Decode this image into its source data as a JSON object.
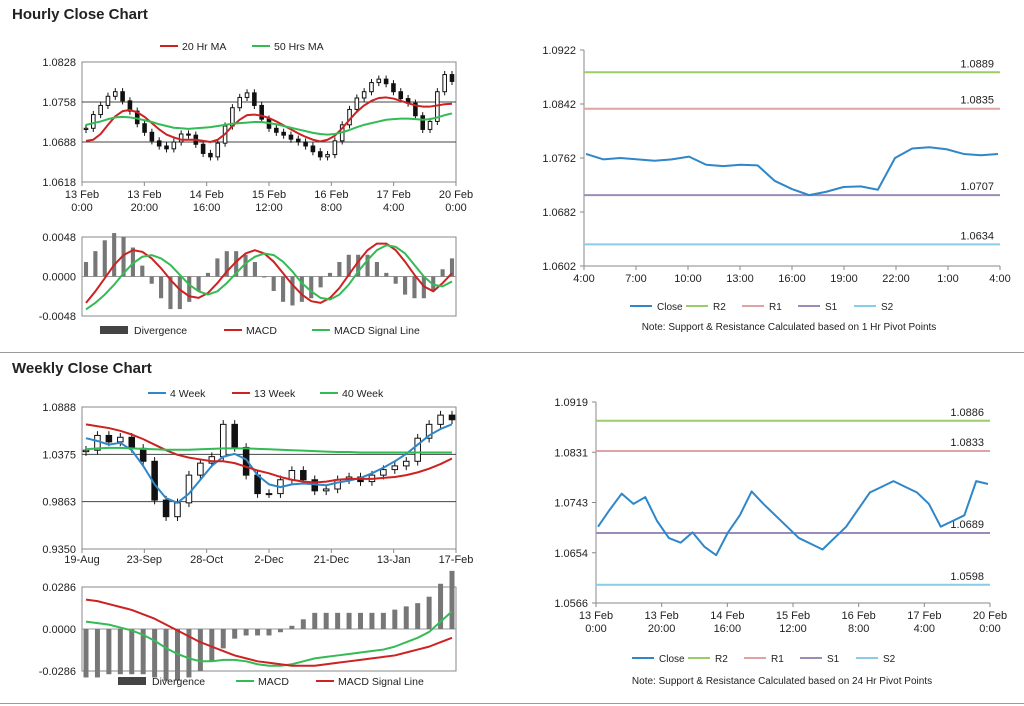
{
  "sections": {
    "hourly_title": "Hourly Close Chart",
    "weekly_title": "Weekly Close Chart"
  },
  "colors": {
    "red": "#cc2222",
    "green": "#33bb55",
    "blue": "#2f86c8",
    "r2": "#9ccc6a",
    "r1": "#e0a3a3",
    "s1": "#9b8bb8",
    "s2": "#88cce6",
    "bar": "#777777"
  },
  "chart_data": [
    {
      "id": "hourly_price",
      "type": "candlestick",
      "legend": [
        "20 Hr MA",
        "50 Hrs MA"
      ],
      "yticks": [
        "1.0828",
        "1.0758",
        "1.0688",
        "1.0618"
      ],
      "ylim": [
        1.0618,
        1.0828
      ],
      "xticks": [
        [
          "13 Feb",
          "0:00"
        ],
        [
          "13 Feb",
          "20:00"
        ],
        [
          "14 Feb",
          "16:00"
        ],
        [
          "15 Feb",
          "12:00"
        ],
        [
          "16 Feb",
          "8:00"
        ],
        [
          "17 Feb",
          "4:00"
        ],
        [
          "20 Feb",
          "0:00"
        ]
      ],
      "close": [
        1.0712,
        1.0736,
        1.0752,
        1.0768,
        1.0776,
        1.076,
        1.0742,
        1.072,
        1.0705,
        1.069,
        1.0681,
        1.0676,
        1.0688,
        1.0702,
        1.07,
        1.0684,
        1.0668,
        1.0662,
        1.0686,
        1.0716,
        1.0748,
        1.0766,
        1.0774,
        1.0752,
        1.0728,
        1.0712,
        1.0705,
        1.07,
        1.0693,
        1.0688,
        1.0681,
        1.0671,
        1.0662,
        1.0666,
        1.069,
        1.0718,
        1.0745,
        1.0765,
        1.0776,
        1.0792,
        1.0798,
        1.079,
        1.0776,
        1.0764,
        1.0756,
        1.0734,
        1.071,
        1.0724,
        1.0776,
        1.0806,
        1.0794
      ],
      "ma20": [
        1.069,
        1.0692,
        1.0702,
        1.0718,
        1.0733,
        1.0742,
        1.0744,
        1.074,
        1.0732,
        1.0721,
        1.071,
        1.0701,
        1.0696,
        1.0692,
        1.0692,
        1.0692,
        1.069,
        1.0688,
        1.0692,
        1.0702,
        1.0716,
        1.0727,
        1.0735,
        1.0736,
        1.0734,
        1.073,
        1.0724,
        1.0717,
        1.071,
        1.0703,
        1.0697,
        1.0692,
        1.0689,
        1.0692,
        1.0699,
        1.0712,
        1.0727,
        1.0741,
        1.0752,
        1.076,
        1.0765,
        1.0766,
        1.0764,
        1.076,
        1.0756,
        1.0752,
        1.075,
        1.075,
        1.0752,
        1.0754,
        1.0755
      ],
      "ma50": [
        1.0718,
        1.0721,
        1.0724,
        1.0728,
        1.0731,
        1.0732,
        1.0731,
        1.0729,
        1.0726,
        1.0723,
        1.0719,
        1.0716,
        1.0713,
        1.0712,
        1.0711,
        1.0712,
        1.0713,
        1.0714,
        1.0716,
        1.0718,
        1.072,
        1.0721,
        1.0722,
        1.0723,
        1.0723,
        1.0721,
        1.0719,
        1.0716,
        1.0713,
        1.071,
        1.0707,
        1.0704,
        1.0702,
        1.0701,
        1.0702,
        1.0705,
        1.0709,
        1.0714,
        1.0718,
        1.0721,
        1.0724,
        1.0727,
        1.0728,
        1.0729,
        1.0729,
        1.0728,
        1.0727,
        1.0728,
        1.0731,
        1.0735,
        1.0738
      ]
    },
    {
      "id": "hourly_macd",
      "type": "macd",
      "yticks": [
        "0.0048",
        "0.0000",
        "-0.0048"
      ],
      "ylim": [
        -0.0048,
        0.0048
      ],
      "legend": [
        "Divergence",
        "MACD",
        "MACD Signal Line"
      ],
      "macd": [
        -0.0032,
        -0.0018,
        -0.0002,
        0.0014,
        0.0026,
        0.0032,
        0.003,
        0.0022,
        0.001,
        -0.0004,
        -0.0016,
        -0.0024,
        -0.0026,
        -0.002,
        -0.0008,
        0.0006,
        0.0018,
        0.0028,
        0.0032,
        0.0028,
        0.0018,
        0.0004,
        -0.001,
        -0.0022,
        -0.003,
        -0.0032,
        -0.0026,
        -0.0014,
        0.0002,
        0.0018,
        0.0032,
        0.004,
        0.004,
        0.0032,
        0.0018,
        0.0002,
        -0.0012,
        -0.0018,
        -0.0008,
        0.0004
      ],
      "signal": [
        -0.004,
        -0.0032,
        -0.0022,
        -0.001,
        0.0004,
        0.0016,
        0.0024,
        0.0026,
        0.0022,
        0.0014,
        0.0002,
        -0.001,
        -0.0018,
        -0.0022,
        -0.0018,
        -0.0008,
        0.0004,
        0.0016,
        0.0024,
        0.0028,
        0.0026,
        0.0018,
        0.0006,
        -0.0008,
        -0.0018,
        -0.0026,
        -0.0028,
        -0.0022,
        -0.001,
        0.0006,
        0.002,
        0.0032,
        0.0038,
        0.0036,
        0.0028,
        0.0014,
        0.0,
        -0.001,
        -0.0012,
        -0.0006
      ]
    },
    {
      "id": "hourly_pivots",
      "type": "line",
      "ylim": [
        1.0602,
        1.0922
      ],
      "yticks": [
        "1.0922",
        "1.0842",
        "1.0762",
        "1.0682",
        "1.0602"
      ],
      "xticks": [
        "4:00",
        "7:00",
        "10:00",
        "13:00",
        "16:00",
        "19:00",
        "22:00",
        "1:00",
        "4:00"
      ],
      "close": [
        1.0768,
        1.076,
        1.0762,
        1.076,
        1.0758,
        1.076,
        1.0764,
        1.0752,
        1.075,
        1.0752,
        1.0751,
        1.0728,
        1.0716,
        1.0707,
        1.0712,
        1.0719,
        1.072,
        1.0715,
        1.0762,
        1.0776,
        1.0778,
        1.0775,
        1.0768,
        1.0766,
        1.0768
      ],
      "levels": [
        {
          "name": "R2",
          "value": 1.0889,
          "label": "1.0889"
        },
        {
          "name": "R1",
          "value": 1.0835,
          "label": "1.0835"
        },
        {
          "name": "S1",
          "value": 1.0707,
          "label": "1.0707"
        },
        {
          "name": "S2",
          "value": 1.0634,
          "label": "1.0634"
        }
      ],
      "legend": [
        "Close",
        "R2",
        "R1",
        "S1",
        "S2"
      ],
      "note": "Note: Support & Resistance Calculated based on 1 Hr Pivot Points"
    },
    {
      "id": "weekly_price",
      "type": "candlestick",
      "legend": [
        "4 Week",
        "13 Week",
        "40 Week"
      ],
      "yticks": [
        "1.0888",
        "1.0375",
        "0.9863",
        "0.9350"
      ],
      "ylim": [
        0.935,
        1.0888
      ],
      "xticks": [
        "19-Aug",
        "23-Sep",
        "28-Oct",
        "2-Dec",
        "21-Dec",
        "13-Jan",
        "17-Feb"
      ],
      "close": [
        1.042,
        1.058,
        1.051,
        1.056,
        1.044,
        1.03,
        0.988,
        0.97,
        0.985,
        1.015,
        1.028,
        1.035,
        1.07,
        1.045,
        1.015,
        0.995,
        0.995,
        1.01,
        1.02,
        1.01,
        0.998,
        1.0,
        1.01,
        1.013,
        1.008,
        1.015,
        1.021,
        1.025,
        1.03,
        1.055,
        1.07,
        1.08,
        1.075
      ],
      "ma4": [
        1.055,
        1.052,
        1.048,
        1.05,
        1.042,
        1.025,
        1.005,
        0.99,
        0.985,
        0.995,
        1.01,
        1.025,
        1.035,
        1.038,
        1.032,
        1.015,
        1.005,
        1.002,
        1.005,
        1.006,
        1.005,
        1.004,
        1.007,
        1.009,
        1.012,
        1.017,
        1.023,
        1.03,
        1.038,
        1.048,
        1.058,
        1.065,
        1.07
      ],
      "ma13": [
        1.07,
        1.068,
        1.066,
        1.063,
        1.059,
        1.054,
        1.048,
        1.042,
        1.037,
        1.034,
        1.032,
        1.03,
        1.03,
        1.028,
        1.024,
        1.02,
        1.017,
        1.013,
        1.01,
        1.008,
        1.007,
        1.008,
        1.01,
        1.011,
        1.011,
        1.011,
        1.012,
        1.013,
        1.015,
        1.018,
        1.022,
        1.027,
        1.033
      ],
      "ma40": [
        1.043,
        1.044,
        1.0445,
        1.0445,
        1.044,
        1.0435,
        1.043,
        1.0425,
        1.0425,
        1.0425,
        1.043,
        1.0435,
        1.044,
        1.044,
        1.044,
        1.0435,
        1.043,
        1.0425,
        1.042,
        1.0415,
        1.041,
        1.0405,
        1.04,
        1.04,
        1.0395,
        1.0395,
        1.0395,
        1.0395,
        1.0395,
        1.0395,
        1.0395,
        1.0395,
        1.0395
      ]
    },
    {
      "id": "weekly_macd",
      "type": "macd",
      "yticks": [
        "0.0286",
        "0.0000",
        "-0.0286"
      ],
      "ylim": [
        -0.0286,
        0.0286
      ],
      "legend": [
        "Divergence",
        "MACD",
        "MACD Signal Line"
      ],
      "macd": [
        0.005,
        0.004,
        0.003,
        0.001,
        -0.001,
        -0.004,
        -0.008,
        -0.013,
        -0.017,
        -0.02,
        -0.022,
        -0.022,
        -0.021,
        -0.021,
        -0.022,
        -0.024,
        -0.025,
        -0.025,
        -0.024,
        -0.022,
        -0.02,
        -0.019,
        -0.018,
        -0.017,
        -0.016,
        -0.015,
        -0.014,
        -0.012,
        -0.009,
        -0.006,
        -0.002,
        0.005,
        0.012
      ],
      "signal": [
        0.02,
        0.019,
        0.017,
        0.015,
        0.013,
        0.01,
        0.007,
        0.003,
        -0.001,
        -0.005,
        -0.009,
        -0.012,
        -0.015,
        -0.018,
        -0.02,
        -0.022,
        -0.023,
        -0.024,
        -0.025,
        -0.025,
        -0.025,
        -0.024,
        -0.023,
        -0.022,
        -0.021,
        -0.02,
        -0.019,
        -0.018,
        -0.016,
        -0.014,
        -0.012,
        -0.009,
        -0.006
      ]
    },
    {
      "id": "weekly_pivots",
      "type": "line",
      "ylim": [
        1.0566,
        1.0919
      ],
      "yticks": [
        "1.0919",
        "1.0831",
        "1.0743",
        "1.0654",
        "1.0566"
      ],
      "xticks": [
        [
          "13 Feb",
          "0:00"
        ],
        [
          "13 Feb",
          "20:00"
        ],
        [
          "14 Feb",
          "16:00"
        ],
        [
          "15 Feb",
          "12:00"
        ],
        [
          "16 Feb",
          "8:00"
        ],
        [
          "17 Feb",
          "4:00"
        ],
        [
          "20 Feb",
          "0:00"
        ]
      ],
      "close": [
        1.07,
        1.073,
        1.0758,
        1.074,
        1.0752,
        1.071,
        1.068,
        1.0672,
        1.069,
        1.0665,
        1.065,
        1.069,
        1.072,
        1.0762,
        1.074,
        1.072,
        1.07,
        1.068,
        1.067,
        1.066,
        1.068,
        1.07,
        1.073,
        1.076,
        1.077,
        1.078,
        1.077,
        1.076,
        1.074,
        1.07,
        1.071,
        1.072,
        1.078,
        1.0775
      ],
      "levels": [
        {
          "name": "R2",
          "value": 1.0886,
          "label": "1.0886"
        },
        {
          "name": "R1",
          "value": 1.0833,
          "label": "1.0833"
        },
        {
          "name": "S1",
          "value": 1.0689,
          "label": "1.0689"
        },
        {
          "name": "S2",
          "value": 1.0598,
          "label": "1.0598"
        }
      ],
      "legend": [
        "Close",
        "R2",
        "R1",
        "S1",
        "S2"
      ],
      "note": "Note: Support & Resistance Calculated based on 24 Hr Pivot Points"
    }
  ]
}
